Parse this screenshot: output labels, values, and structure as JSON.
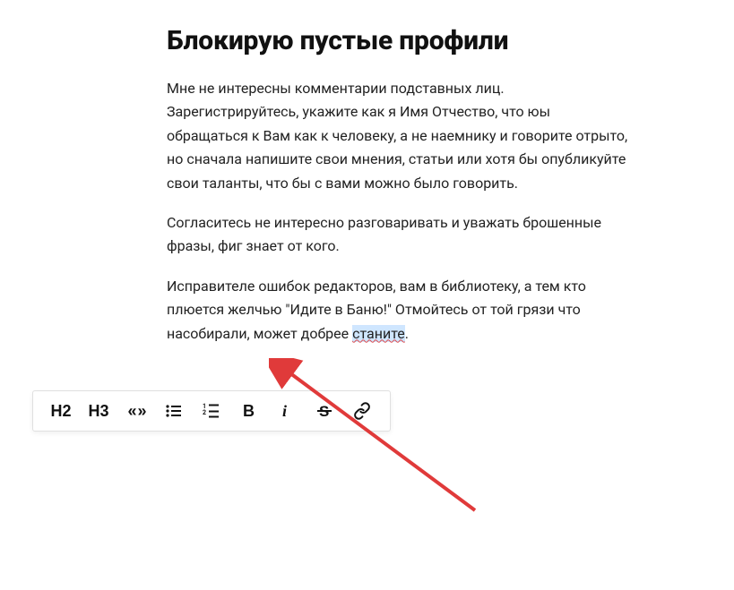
{
  "article": {
    "title": "Блокирую пустые профили",
    "paragraphs": [
      "Мне не интересны комментарии подставных лиц. Зарегистрируйтесь, укажите как я Имя Отчество, что юы обращаться к Вам как к человеку, а не наемнику и говорите отрыто, но сначала напишите свои мнения, статьи или хотя бы опубликуйте свои таланты, что бы с вами можно было говорить.",
      "Согласитесь не интересно разговаривать и уважать брошенные фразы, фиг знает от кого."
    ],
    "lastParagraph": {
      "before": "Исправителе ошибок редакторов, вам в библиотеку, а тем кто плюется желчью \"Идите в Баню!\" Отмойтесь от той грязи что насобирали, может добрее ",
      "highlighted": "станите",
      "after": "."
    }
  },
  "toolbar": {
    "h2": "H2",
    "h3": "H3",
    "quote": "« »"
  },
  "annotation": {
    "arrow_color": "#e03a3a"
  }
}
